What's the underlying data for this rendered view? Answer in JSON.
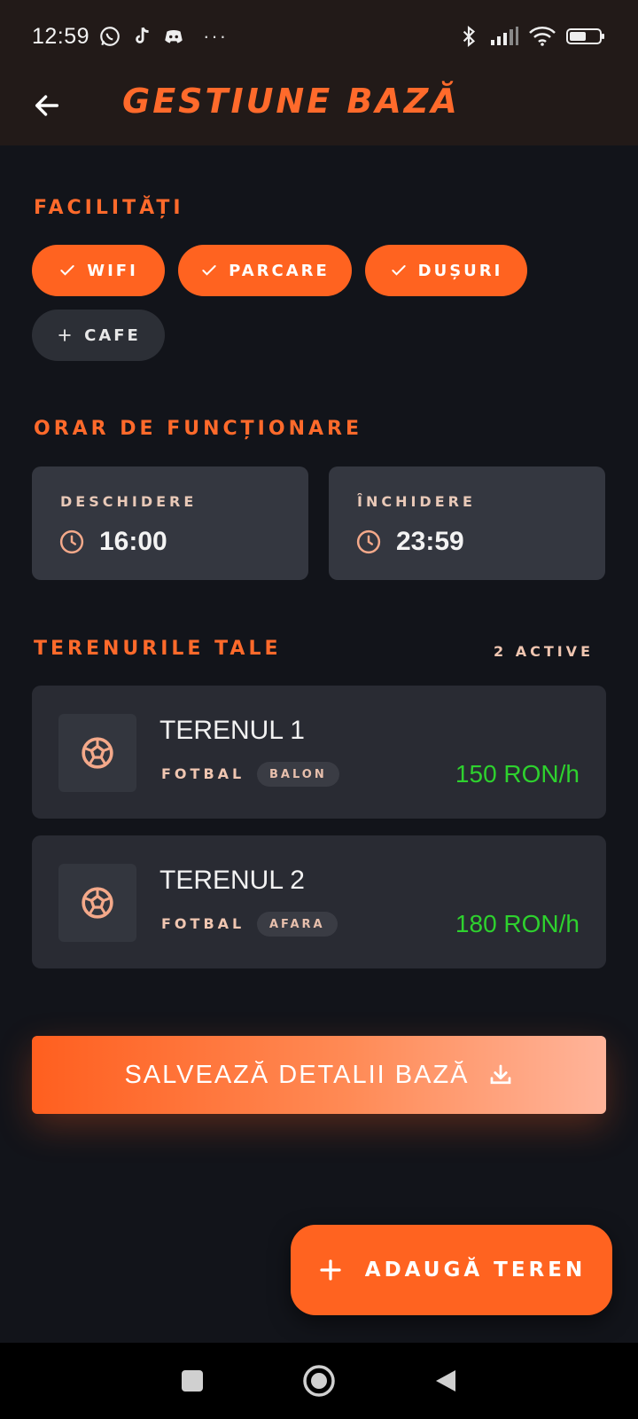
{
  "status_bar": {
    "time": "12:59",
    "left_icons": [
      "whatsapp-icon",
      "tiktok-icon",
      "discord-icon"
    ],
    "more": "···",
    "right_icons": [
      "bluetooth-icon",
      "signal-icon",
      "wifi-icon",
      "battery-icon"
    ]
  },
  "app_bar": {
    "title": "GESTIUNE BAZĂ",
    "back_icon": "arrow-left-icon"
  },
  "facilities": {
    "title": "FACILITĂȚI",
    "chips": [
      {
        "label": "WIFI",
        "selected": true
      },
      {
        "label": "PARCARE",
        "selected": true
      },
      {
        "label": "DUȘURI",
        "selected": true
      },
      {
        "label": "CAFE",
        "selected": false
      }
    ]
  },
  "schedule": {
    "title": "ORAR DE FUNCȚIONARE",
    "open": {
      "label": "DESCHIDERE",
      "value": "16:00"
    },
    "close": {
      "label": "ÎNCHIDERE",
      "value": "23:59"
    }
  },
  "courts": {
    "title": "TERENURILE TALE",
    "active_count": "2 ACTIVE",
    "items": [
      {
        "name": "TERENUL 1",
        "sport": "FOTBAL",
        "tag": "BALON",
        "price": "150 RON/h"
      },
      {
        "name": "TERENUL 2",
        "sport": "FOTBAL",
        "tag": "AFARA",
        "price": "180 RON/h"
      }
    ]
  },
  "save_button": {
    "label": "SALVEAZĂ DETALII BAZĂ"
  },
  "add_button": {
    "label": "ADAUGĂ TEREN"
  },
  "colors": {
    "accent": "#ff6320",
    "price": "#2ed12e",
    "background": "#12141a",
    "card": "#292b33"
  }
}
